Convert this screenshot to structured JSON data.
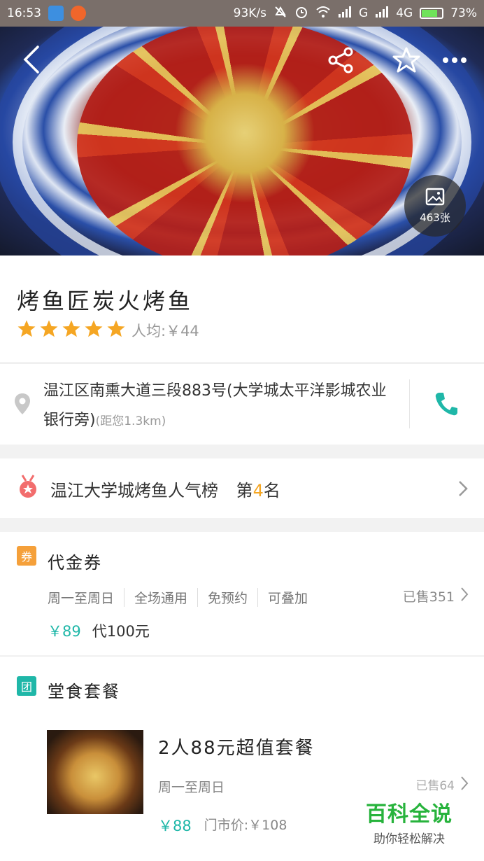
{
  "status_bar": {
    "time": "16:53",
    "net_speed": "93K/s",
    "signal_1": "G",
    "signal_2": "4G",
    "battery_pct": "73%",
    "battery_level": 0.73
  },
  "hero": {
    "photo_count": "463张"
  },
  "shop": {
    "name": "烤鱼匠炭火烤鱼",
    "rating": 5,
    "avg_price": "人均:￥44"
  },
  "address": {
    "text": "温江区南熏大道三段883号(大学城太平洋影城农业银行旁)",
    "distance": "(距您1.3km)"
  },
  "rank": {
    "prefix": "温江大学城烤鱼人气榜",
    "label_before": "第",
    "number": "4",
    "label_after": "名"
  },
  "coupon": {
    "tag": "券",
    "title": "代金券",
    "features": [
      "周一至周日",
      "全场通用",
      "免预约",
      "可叠加"
    ],
    "sold": "已售351",
    "price": "￥89",
    "value": "代100元"
  },
  "meal": {
    "tag": "团",
    "title": "堂食套餐",
    "item_name": "2人88元超值套餐",
    "item_days": "周一至周日",
    "item_sold": "已售64",
    "item_price": "￥88",
    "item_orig": "门市价:￥108"
  },
  "watermark": {
    "big": "百科全说",
    "small": "助你轻松解决"
  },
  "colors": {
    "accent_teal": "#1fb7a8",
    "star_orange": "#f5a623",
    "coupon_orange": "#f5a03a"
  }
}
